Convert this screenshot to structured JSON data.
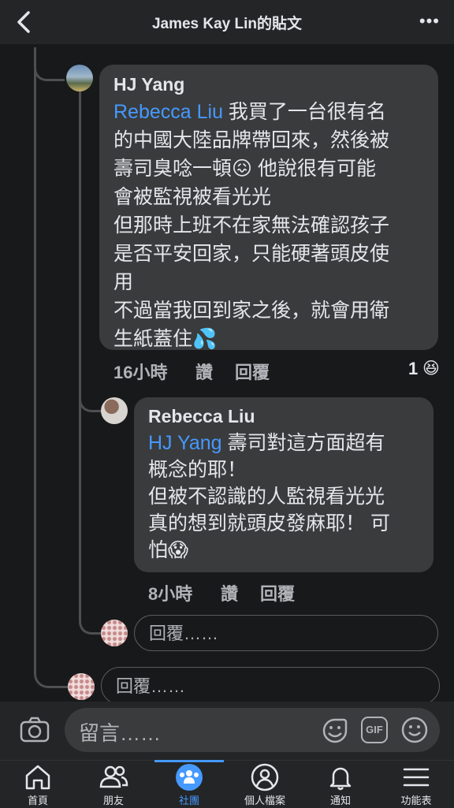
{
  "header": {
    "title": "James Kay Lin的貼文"
  },
  "comment1": {
    "author": "HJ Yang",
    "lines": [
      {
        "mention": "Rebecca Liu",
        "text": " 我買了一台很有名"
      },
      {
        "text": "的中國大陸品牌帶回來，然後被"
      },
      {
        "text": "壽司臭唸一頓😖 他說很有可能"
      },
      {
        "text": "會被監視被看光光"
      },
      {
        "text": "但那時上班不在家無法確認孩子"
      },
      {
        "text": "是否平安回家，只能硬著頭皮使"
      },
      {
        "text": "用"
      },
      {
        "text": "不過當我回到家之後，就會用衛"
      },
      {
        "text": "生紙蓋住💦"
      }
    ],
    "time": "16小時",
    "like": "讚",
    "reply": "回覆",
    "reaction_count": "1",
    "reaction_icon": "😆"
  },
  "comment2": {
    "author": "Rebecca Liu",
    "lines": [
      {
        "mention": "HJ Yang",
        "text": " 壽司對這方面超有"
      },
      {
        "text": "概念的耶！"
      },
      {
        "text": "但被不認識的人監視看光光"
      },
      {
        "text": "真的想到就頭皮發麻耶！ 可"
      },
      {
        "text": "怕😱"
      }
    ],
    "time": "8小時",
    "like": "讚",
    "reply": "回覆"
  },
  "reply_box_inner": {
    "placeholder": "回覆……"
  },
  "reply_box_outer": {
    "placeholder": "回覆……"
  },
  "composer": {
    "placeholder": "留言……",
    "gif": "GIF"
  },
  "tabs": [
    {
      "label": "首頁",
      "icon": "home-icon"
    },
    {
      "label": "朋友",
      "icon": "friends-icon"
    },
    {
      "label": "社團",
      "icon": "groups-icon",
      "active": true
    },
    {
      "label": "個人檔案",
      "icon": "profile-icon"
    },
    {
      "label": "通知",
      "icon": "bell-icon"
    },
    {
      "label": "功能表",
      "icon": "menu-icon"
    }
  ],
  "colors": {
    "background": "#18191a",
    "bubble": "#3a3b3c",
    "mention": "#4599ff",
    "accent": "#4599ff"
  }
}
